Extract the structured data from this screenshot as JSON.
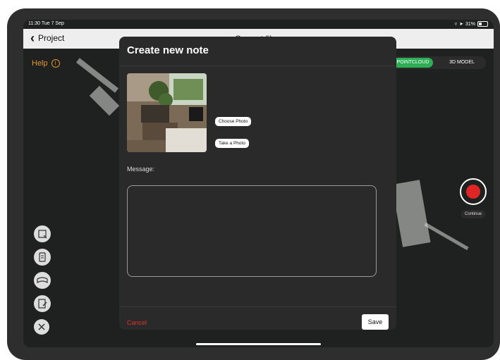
{
  "statusbar": {
    "time": "11:30  Tue 7 Sep",
    "battery": "31%"
  },
  "navbar": {
    "back_label": "Project",
    "title": "Current file"
  },
  "help": {
    "label": "Help",
    "icon": "info-icon"
  },
  "view_toggle": {
    "active": "POINTCLOUD",
    "inactive": "3D MODEL",
    "active_color": "#2dae55"
  },
  "record": {
    "continue_label": "Continue",
    "color": "#e02525"
  },
  "tools": [
    {
      "name": "scan-area-icon"
    },
    {
      "name": "device-icon"
    },
    {
      "name": "panorama-icon"
    },
    {
      "name": "edit-note-icon"
    },
    {
      "name": "close-icon"
    }
  ],
  "modal": {
    "title": "Create new note",
    "choose_photo": "Choose Photo",
    "take_photo": "Take a Photo",
    "message_label": "Message:",
    "message_value": "",
    "cancel": "Cancel",
    "save": "Save",
    "cancel_color": "#e0332c"
  }
}
